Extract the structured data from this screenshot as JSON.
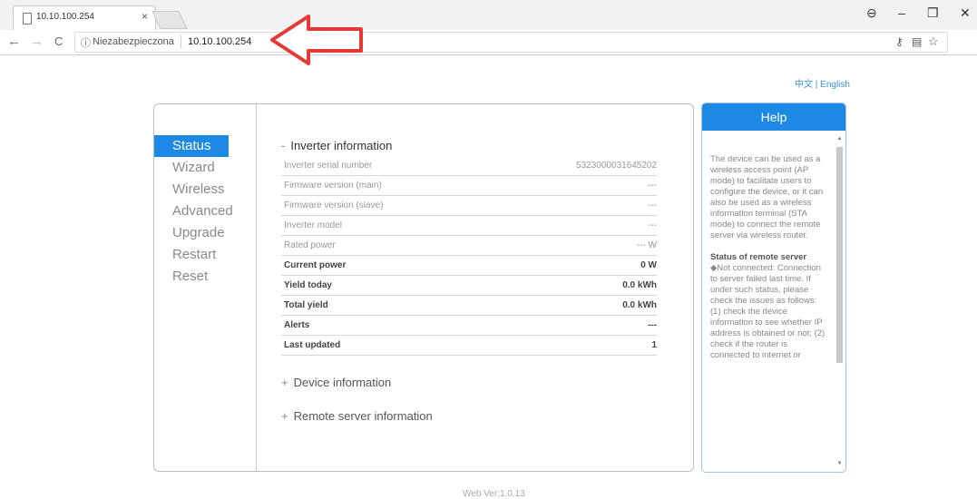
{
  "browser": {
    "tab_title": "10.10.100.254",
    "tab_close": "×",
    "address_insecure": "Niezabezpieczona",
    "address_url": "10.10.100.254",
    "window_controls": {
      "account": "⊖",
      "minimize": "–",
      "maximize": "❐",
      "close": "✕"
    },
    "nav": {
      "back": "←",
      "forward": "→",
      "reload": "C"
    }
  },
  "page": {
    "language_links": "中文 | English",
    "menu": [
      "Status",
      "Wizard",
      "Wireless",
      "Advanced",
      "Upgrade",
      "Restart",
      "Reset"
    ],
    "active_menu": "Status",
    "inverter_section": {
      "toggle": "-",
      "title": "Inverter information",
      "rows": [
        {
          "label": "Inverter serial number",
          "value": "5323000031645202",
          "bold": false
        },
        {
          "label": "Firmware version (main)",
          "value": "---",
          "bold": false
        },
        {
          "label": "Firmware version (slave)",
          "value": "---",
          "bold": false
        },
        {
          "label": "Inverter model",
          "value": "---",
          "bold": false
        },
        {
          "label": "Rated power",
          "value": "--- W",
          "bold": false
        },
        {
          "label": "Current power",
          "value": "0 W",
          "bold": true
        },
        {
          "label": "Yield today",
          "value": "0.0 kWh",
          "bold": true
        },
        {
          "label": "Total yield",
          "value": "0.0 kWh",
          "bold": true
        },
        {
          "label": "Alerts",
          "value": "---",
          "bold": true
        },
        {
          "label": "Last updated",
          "value": "1",
          "bold": true
        }
      ]
    },
    "device_section": {
      "toggle": "+",
      "title": "Device information"
    },
    "remote_section": {
      "toggle": "+",
      "title": "Remote server information"
    },
    "help": {
      "title": "Help",
      "intro": "The device can be used as a wireless access point (AP mode) to facilitate users to configure the device, or it can also be used as a wireless information terminal (STA mode) to connect the remote server via wireless router.",
      "remote_heading": "Status of remote server",
      "remote_text": "◆Not connected: Connection to server failed last time. If under such status, please check the issues as follows: (1) check the device information to see whether IP address is obtained or not; (2) check if the router is connected to internet or"
    },
    "footer": "Web Ver:1.0.13"
  },
  "colors": {
    "accent": "#1e88e5",
    "arrow": "#e53935"
  }
}
